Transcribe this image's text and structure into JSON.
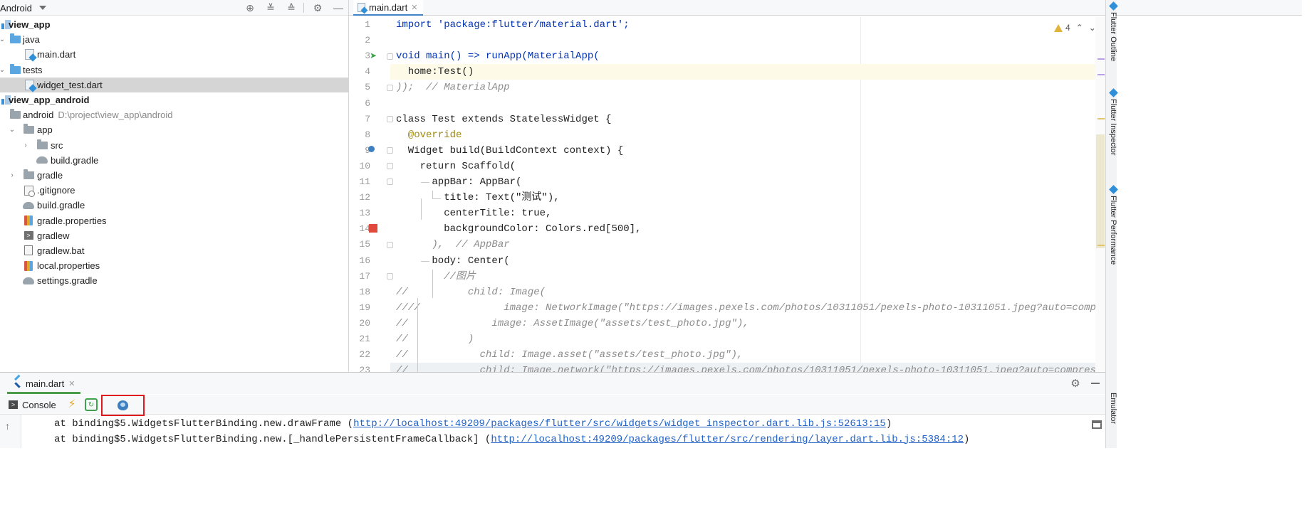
{
  "project_panel": {
    "view_selector": "Android",
    "tree": [
      {
        "label": "view_app",
        "bold": true,
        "icon": "module-icon"
      },
      {
        "label": "java",
        "icon": "folder-icon"
      },
      {
        "label": "main.dart",
        "icon": "dart-file-icon"
      },
      {
        "label": "tests",
        "icon": "folder-icon"
      },
      {
        "label": "widget_test.dart",
        "icon": "dart-file-icon",
        "selected": true
      },
      {
        "label": "view_app_android",
        "bold": true,
        "icon": "module-icon"
      },
      {
        "label": "android",
        "path": "D:\\project\\view_app\\android",
        "icon": "folder-icon"
      },
      {
        "label": "app",
        "icon": "folder-icon"
      },
      {
        "label": "src",
        "icon": "folder-icon"
      },
      {
        "label": "build.gradle",
        "icon": "gradle-icon"
      },
      {
        "label": "gradle",
        "icon": "folder-icon"
      },
      {
        "label": ".gitignore",
        "icon": "gitignore-icon"
      },
      {
        "label": "build.gradle",
        "icon": "gradle-icon"
      },
      {
        "label": "gradle.properties",
        "icon": "properties-icon"
      },
      {
        "label": "gradlew",
        "icon": "terminal-icon"
      },
      {
        "label": "gradlew.bat",
        "icon": "text-file-icon"
      },
      {
        "label": "local.properties",
        "icon": "properties-icon"
      },
      {
        "label": "settings.gradle",
        "icon": "gradle-icon"
      }
    ]
  },
  "editor": {
    "tab": "main.dart",
    "inspection_count": "4",
    "line_numbers": [
      "1",
      "2",
      "3",
      "4",
      "5",
      "6",
      "7",
      "8",
      "9",
      "10",
      "11",
      "12",
      "13",
      "14",
      "15",
      "16",
      "17",
      "18",
      "19",
      "20",
      "21",
      "22",
      "23"
    ],
    "lines": [
      "import 'package:flutter/material.dart';",
      "",
      "void main() => runApp(MaterialApp(",
      "  home:Test()",
      "));  // MaterialApp",
      "",
      "class Test extends StatelessWidget {",
      "  @override",
      "  Widget build(BuildContext context) {",
      "    return Scaffold(",
      "      appBar: AppBar(",
      "        title: Text(\"测试\"),",
      "        centerTitle: true,",
      "        backgroundColor: Colors.red[500],",
      "      ),  // AppBar",
      "      body: Center(",
      "        //图片",
      "//          child: Image(",
      "////              image: NetworkImage(\"https://images.pexels.com/photos/10311051/pexels-photo-10311051.jpeg?auto=compress&cs=",
      "//              image: AssetImage(\"assets/test_photo.jpg\"),",
      "//          )",
      "//            child: Image.asset(\"assets/test_photo.jpg\"),",
      "//            child: Image.network(\"https://images.pexels.com/photos/10311051/pexels-photo-10311051.jpeg?auto=compress&cs=ti"
    ]
  },
  "right_tool_windows": [
    "Flutter Outline",
    "Flutter Inspector",
    "Flutter Performance",
    "Emulator"
  ],
  "run_panel": {
    "tab": "main.dart",
    "console_label": "Console",
    "console_lines": [
      {
        "prefix": "at binding$5.WidgetsFlutterBinding.new.drawFrame (",
        "link": "http://localhost:49209/packages/flutter/src/widgets/widget_inspector.dart.lib.js:52613:15",
        "suffix": ")"
      },
      {
        "prefix": "at binding$5.WidgetsFlutterBinding.new.[_handlePersistentFrameCallback] (",
        "link": "http://localhost:49209/packages/flutter/src/rendering/layer.dart.lib.js:5384:12",
        "suffix": ")"
      }
    ]
  },
  "colors": {
    "highlight_box": "#e0191f",
    "keyword": "#0033b3",
    "string": "#067d17",
    "link": "#2262c6"
  }
}
